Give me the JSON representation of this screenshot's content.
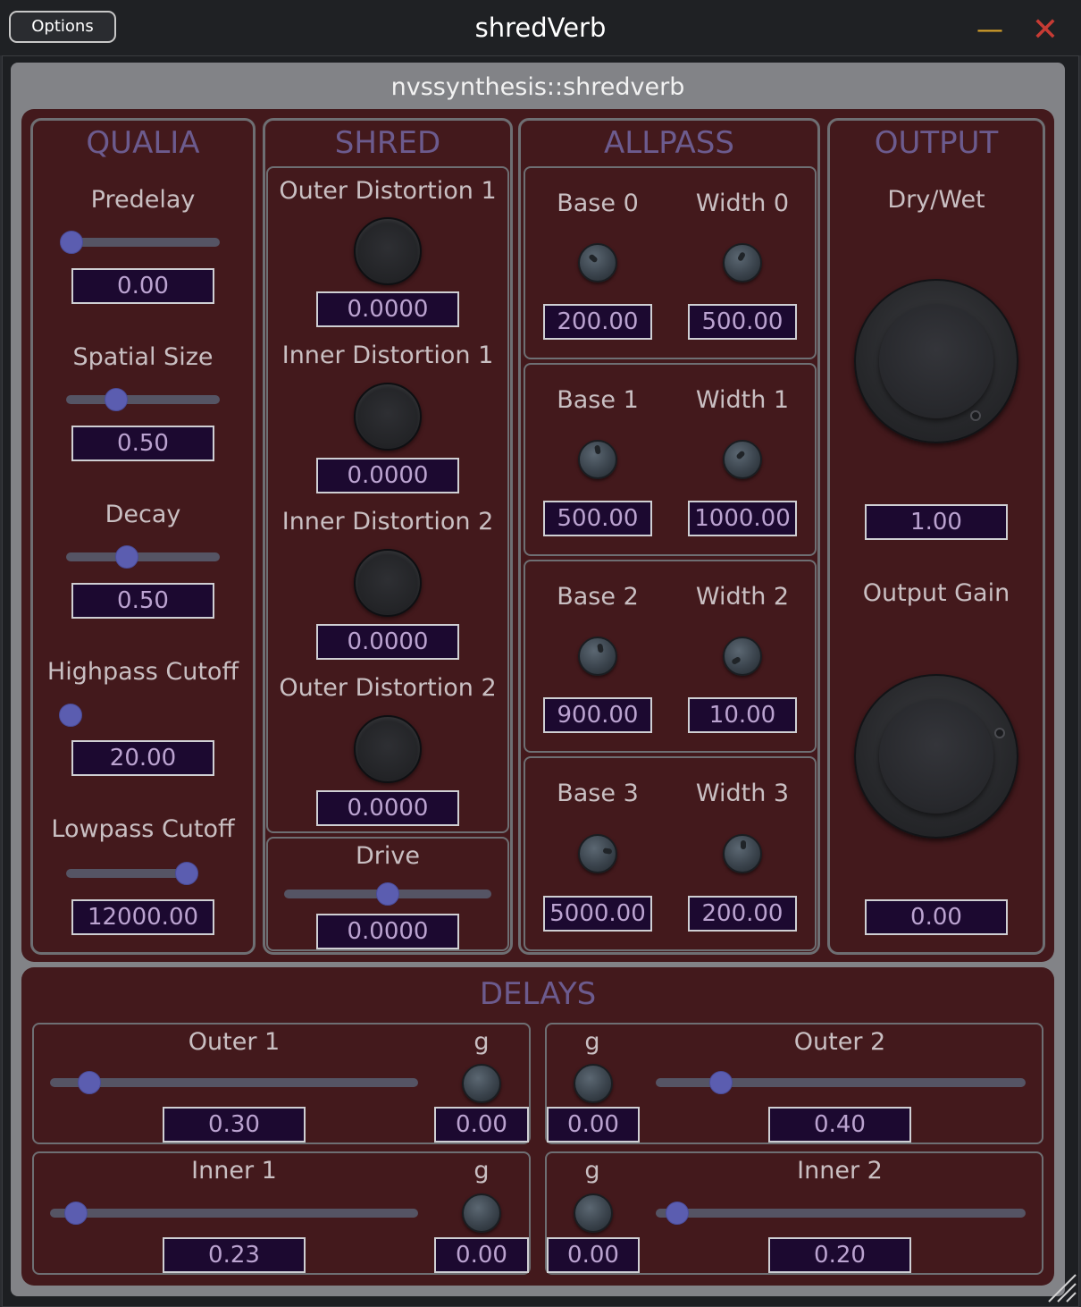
{
  "window": {
    "options_label": "Options",
    "title": "shredVerb",
    "minimize_glyph": "—",
    "close_glyph": "✕"
  },
  "plugin": {
    "title": "nvssynthesis::shredverb"
  },
  "colors": {
    "panel": "#43191c",
    "accent_title": "#6c5b8e",
    "value_text": "#bba3d0",
    "value_bg": "#1c0930",
    "slider_thumb": "#5b5db0"
  },
  "qualia": {
    "title": "QUALIA",
    "predelay": {
      "label": "Predelay",
      "value": "0.00",
      "level": 0.0
    },
    "spatial_size": {
      "label": "Spatial Size",
      "value": "0.50",
      "level": 0.33
    },
    "decay": {
      "label": "Decay",
      "value": "0.50",
      "level": 0.4
    },
    "highpass": {
      "label": "Highpass Cutoff",
      "value": "20.00",
      "level": 0.0
    },
    "lowpass": {
      "label": "Lowpass Cutoff",
      "value": "12000.00",
      "level": 0.8
    }
  },
  "shred": {
    "title": "SHRED",
    "outer_distortion_1": {
      "label": "Outer Distortion 1",
      "value": "0.0000"
    },
    "inner_distortion_1": {
      "label": "Inner Distortion 1",
      "value": "0.0000"
    },
    "inner_distortion_2": {
      "label": "Inner Distortion 2",
      "value": "0.0000"
    },
    "outer_distortion_2": {
      "label": "Outer Distortion 2",
      "value": "0.0000"
    },
    "drive": {
      "label": "Drive",
      "value": "0.0000",
      "level": 0.5
    }
  },
  "allpass": {
    "title": "ALLPASS",
    "stages": [
      {
        "base_label": "Base 0",
        "base_value": "200.00",
        "width_label": "Width 0",
        "width_value": "500.00"
      },
      {
        "base_label": "Base 1",
        "base_value": "500.00",
        "width_label": "Width 1",
        "width_value": "1000.00"
      },
      {
        "base_label": "Base 2",
        "base_value": "900.00",
        "width_label": "Width 2",
        "width_value": "10.00"
      },
      {
        "base_label": "Base 3",
        "base_value": "5000.00",
        "width_label": "Width 3",
        "width_value": "200.00"
      }
    ]
  },
  "output": {
    "title": "OUTPUT",
    "dry_wet": {
      "label": "Dry/Wet",
      "value": "1.00"
    },
    "output_gain": {
      "label": "Output Gain",
      "value": "0.00"
    }
  },
  "delays": {
    "title": "DELAYS",
    "outer_1": {
      "label": "Outer 1",
      "value": "0.30",
      "level": 0.1,
      "g_label": "g",
      "g_value": "0.00"
    },
    "outer_2": {
      "label": "Outer 2",
      "value": "0.40",
      "level": 0.18,
      "g_label": "g",
      "g_value": "0.00"
    },
    "inner_1": {
      "label": "Inner 1",
      "value": "0.23",
      "level": 0.07,
      "g_label": "g",
      "g_value": "0.00"
    },
    "inner_2": {
      "label": "Inner 2",
      "value": "0.20",
      "level": 0.06,
      "g_label": "g",
      "g_value": "0.00"
    }
  }
}
